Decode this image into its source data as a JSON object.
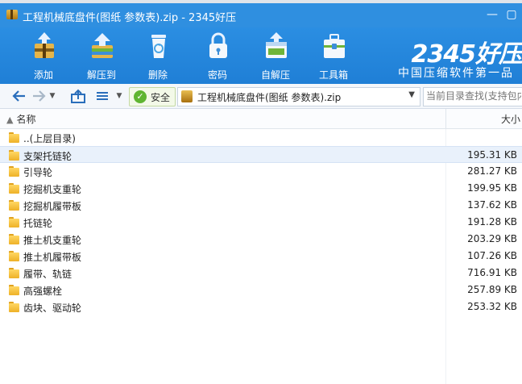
{
  "window": {
    "title": "工程机械底盘件(图纸 参数表).zip - 2345好压"
  },
  "toolbar": {
    "buttons": [
      {
        "label": "添加",
        "icon": "add-icon"
      },
      {
        "label": "解压到",
        "icon": "extract-to-icon"
      },
      {
        "label": "删除",
        "icon": "delete-icon"
      },
      {
        "label": "密码",
        "icon": "lock-icon"
      },
      {
        "label": "自解压",
        "icon": "self-extract-icon"
      },
      {
        "label": "工具箱",
        "icon": "toolbox-icon"
      }
    ],
    "brand_big": "2345好压",
    "brand_small": "中国压缩软件第一品"
  },
  "nav": {
    "secure_label": "安全",
    "path": "工程机械底盘件(图纸 参数表).zip",
    "search_placeholder": "当前目录查找(支持包内"
  },
  "columns": {
    "name": "名称",
    "size": "大小"
  },
  "files": [
    {
      "name": "..(上层目录)",
      "size": ""
    },
    {
      "name": "支架托链轮",
      "size": "195.31 KB"
    },
    {
      "name": "引导轮",
      "size": "281.27 KB"
    },
    {
      "name": "挖掘机支重轮",
      "size": "199.95 KB"
    },
    {
      "name": "挖掘机履带板",
      "size": "137.62 KB"
    },
    {
      "name": "托链轮",
      "size": "191.28 KB"
    },
    {
      "name": "推土机支重轮",
      "size": "203.29 KB"
    },
    {
      "name": "推土机履带板",
      "size": "107.26 KB"
    },
    {
      "name": "履带、轨链",
      "size": "716.91 KB"
    },
    {
      "name": "高强螺栓",
      "size": "257.89 KB"
    },
    {
      "name": "齿块、驱动轮",
      "size": "253.32 KB"
    }
  ],
  "colors": {
    "accent": "#2f8fe0",
    "selection": "#e9f1fb"
  }
}
